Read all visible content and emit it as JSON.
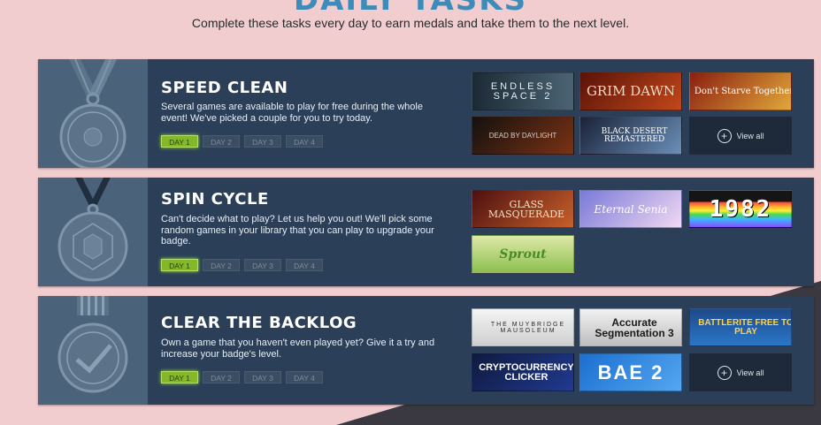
{
  "header": {
    "title": "DAILY TASKS",
    "subtitle": "Complete these tasks every day to earn medals and take them to the next level."
  },
  "tasks": [
    {
      "title": "SPEED CLEAN",
      "description": "Several games are available to play for free during the whole event! We've picked a couple for you to try today.",
      "days": [
        "DAY 1",
        "DAY 2",
        "DAY 3",
        "DAY 4"
      ],
      "active_day": "DAY 1",
      "games": [
        {
          "name": "ENDLESS SPACE 2",
          "colors": [
            "#1c2a35",
            "#4b6474"
          ]
        },
        {
          "name": "GRIM DAWN",
          "colors": [
            "#5a1208",
            "#c2481a"
          ]
        },
        {
          "name": "Don't Starve Together",
          "colors": [
            "#8a1e10",
            "#e2a83a"
          ]
        },
        {
          "name": "DEAD BY DAYLIGHT",
          "colors": [
            "#15110f",
            "#7a3214"
          ]
        },
        {
          "name": "BLACK DESERT REMASTERED",
          "colors": [
            "#1a2238",
            "#6b8fb8"
          ]
        }
      ],
      "view_all": "View all"
    },
    {
      "title": "SPIN CYCLE",
      "description": "Can't decide what to play? Let us help you out! We'll pick some random games in your library that you can play to upgrade your badge.",
      "days": [
        "DAY 1",
        "DAY 2",
        "DAY 3",
        "DAY 4"
      ],
      "active_day": "DAY 1",
      "games": [
        {
          "name": "GLASS MASQUERADE",
          "colors": [
            "#4e1010",
            "#c8602a"
          ]
        },
        {
          "name": "Eternal Senia",
          "colors": [
            "#7a7ad8",
            "#f0d8f2"
          ]
        },
        {
          "name": "1982",
          "colors": [
            "#151515",
            "#ff3a3a"
          ]
        },
        {
          "name": "Sprout",
          "colors": [
            "#dfe9a8",
            "#8cc050"
          ]
        }
      ]
    },
    {
      "title": "CLEAR THE BACKLOG",
      "description": "Own a game that you haven't even played yet? Give it a try and increase your badge's level.",
      "days": [
        "DAY 1",
        "DAY 2",
        "DAY 3",
        "DAY 4"
      ],
      "active_day": "DAY 1",
      "games": [
        {
          "name": "THE MUYBRIDGE MAUSOLEUM",
          "colors": [
            "#f4f4f4",
            "#cfcfcf"
          ]
        },
        {
          "name": "Accurate Segmentation 3",
          "colors": [
            "#f2f2f2",
            "#bdbdbd"
          ]
        },
        {
          "name": "BATTLERITE FREE TO PLAY",
          "colors": [
            "#1d4a8a",
            "#2c76c8"
          ]
        },
        {
          "name": "CRYPTOCURRENCY CLICKER",
          "colors": [
            "#101a40",
            "#1f3a90"
          ]
        },
        {
          "name": "BAE 2",
          "colors": [
            "#1c6fd0",
            "#54a7f0"
          ]
        }
      ],
      "view_all": "View all"
    }
  ]
}
